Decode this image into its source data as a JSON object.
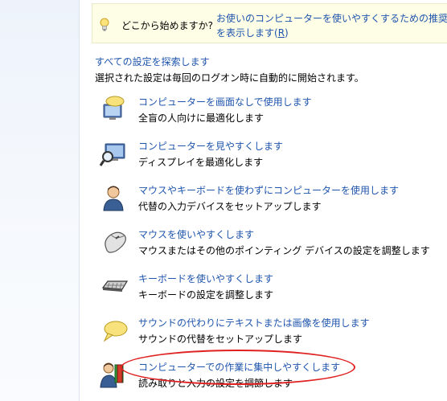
{
  "tip": {
    "prompt": "どこから始めますか?",
    "link_line1": "お使いのコンピューターを使いやすくするための推奨",
    "link_line2_prefix": "を表示します(",
    "link_line2_accel": "R",
    "link_line2_suffix": ")"
  },
  "explore": {
    "link": "すべての設定を探索します",
    "description": "選択された設定は毎回のログオン時に自動的に開始されます。"
  },
  "items": [
    {
      "title": "コンピューターを画面なしで使用します",
      "desc": "全盲の人向けに最適化します",
      "icon": "speech-monitor-icon"
    },
    {
      "title": "コンピューターを見やすくします",
      "desc": "ディスプレイを最適化します",
      "icon": "magnifier-monitor-icon"
    },
    {
      "title": "マウスやキーボードを使わずにコンピューターを使用します",
      "desc": "代替の入力デバイスをセットアップします",
      "icon": "user-icon"
    },
    {
      "title": "マウスを使いやすくします",
      "desc": "マウスまたはその他のポインティング デバイスの設定を調整します",
      "icon": "mouse-icon"
    },
    {
      "title": "キーボードを使いやすくします",
      "desc": "キーボードの設定を調整します",
      "icon": "keyboard-icon"
    },
    {
      "title": "サウンドの代わりにテキストまたは画像を使用します",
      "desc": "サウンドの代替をセットアップします",
      "icon": "speech-bubble-icon"
    },
    {
      "title": "コンピューターでの作業に集中しやすくします",
      "desc": "読み取りと入力の設定を調節します",
      "icon": "user-book-icon"
    }
  ],
  "colors": {
    "link": "#1f55ad",
    "highlight": "#e02020",
    "tip_background": "#fefee6"
  }
}
